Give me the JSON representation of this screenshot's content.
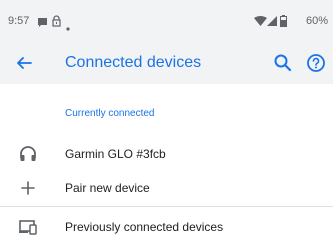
{
  "status_bar": {
    "time": "9:57",
    "battery_percent": "60%",
    "icons": [
      "message-icon",
      "lock-icon",
      "dot-icon",
      "wifi-icon",
      "signal-icon",
      "battery-icon"
    ]
  },
  "app_bar": {
    "title": "Connected devices",
    "icons": [
      "back-arrow-icon",
      "search-icon",
      "help-icon"
    ]
  },
  "section": {
    "title": "Currently connected"
  },
  "items": [
    {
      "label": "Garmin GLO #3fcb",
      "icon": "headset-icon"
    },
    {
      "label": "Pair new device",
      "icon": "plus-icon"
    },
    {
      "label": "Previously connected devices",
      "icon": "devices-icon"
    }
  ],
  "colors": {
    "accent": "#1a73e8",
    "header_bg": "#f1f3f4",
    "text_primary": "#202124",
    "text_secondary": "#5f6368"
  }
}
